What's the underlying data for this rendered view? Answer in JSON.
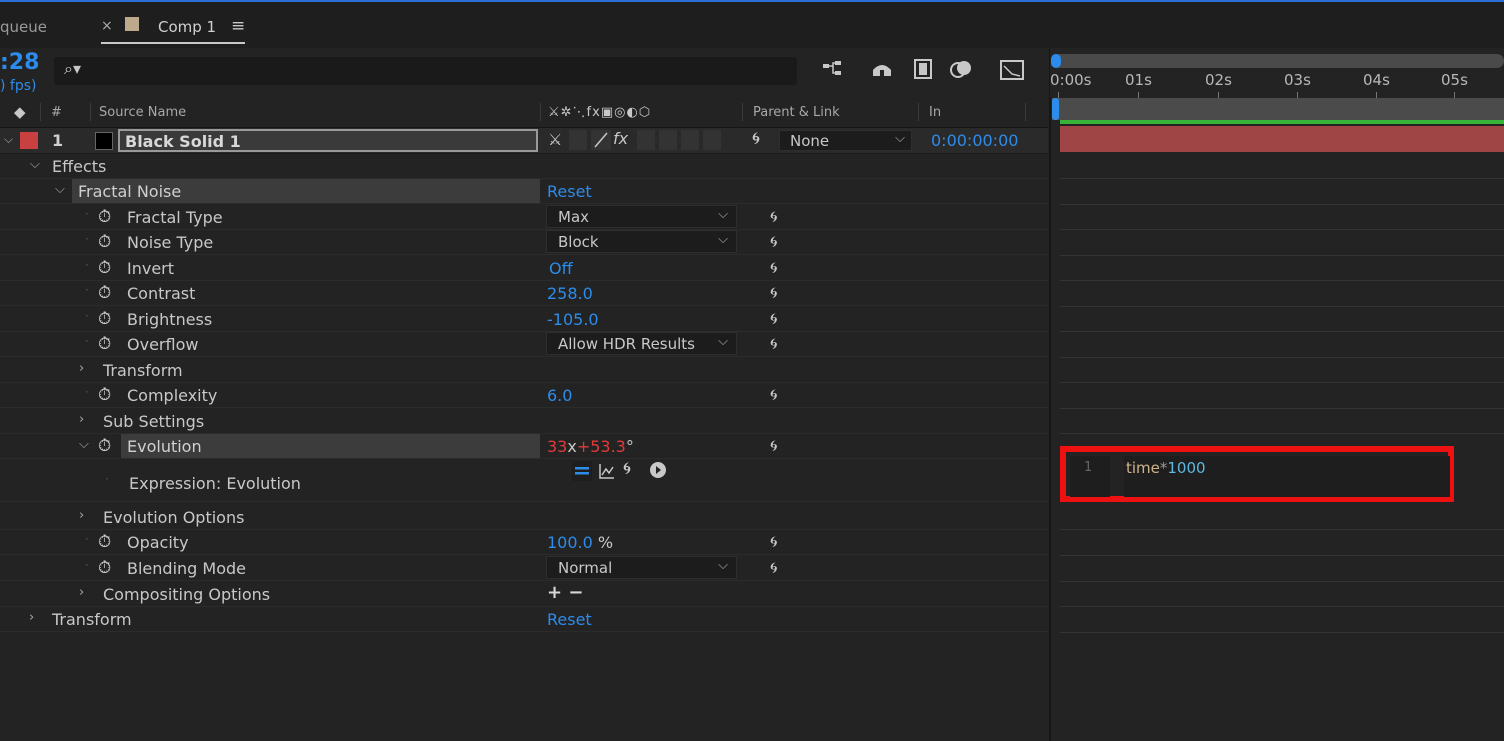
{
  "tabs": {
    "queue_label": "queue",
    "close_symbol": "×",
    "comp_label": "Comp 1",
    "menu_symbol": "≡"
  },
  "toolbar": {
    "timecode": ":28",
    "fps": ") fps)",
    "search_icon": "⌕▾"
  },
  "columns": {
    "tag": "◆",
    "number": "#",
    "source_name": "Source Name",
    "switch_icons": "⚔✲⋱fx▣◎◐⬡",
    "parent_link": "Parent & Link",
    "in": "In"
  },
  "layer": {
    "number": "1",
    "name": "Black Solid 1",
    "parent": "None",
    "in_time": "0:00:00:00",
    "switches": "⚔",
    "label_color": "#c84040"
  },
  "effects_group": "Effects",
  "effect": {
    "name": "Fractal Noise",
    "reset_label": "Reset"
  },
  "properties": {
    "fractal_type": {
      "label": "Fractal Type",
      "value": "Max"
    },
    "noise_type": {
      "label": "Noise Type",
      "value": "Block"
    },
    "invert": {
      "label": "Invert",
      "value": "Off"
    },
    "contrast": {
      "label": "Contrast",
      "value": "258.0"
    },
    "brightness": {
      "label": "Brightness",
      "value": "-105.0"
    },
    "overflow": {
      "label": "Overflow",
      "value": "Allow HDR Results"
    },
    "transform": {
      "label": "Transform"
    },
    "complexity": {
      "label": "Complexity",
      "value": "6.0"
    },
    "sub_settings": {
      "label": "Sub Settings"
    },
    "evolution": {
      "label": "Evolution",
      "revolutions": "33",
      "x": "x",
      "degrees": "+53.3",
      "degree_symbol": "°"
    },
    "expression_label": "Expression: Evolution",
    "evolution_options": {
      "label": "Evolution Options"
    },
    "opacity": {
      "label": "Opacity",
      "value": "100.0",
      "unit": "%"
    },
    "blending_mode": {
      "label": "Blending Mode",
      "value": "Normal"
    },
    "compositing_options": {
      "label": "Compositing Options",
      "add_remove": "+ −"
    }
  },
  "layer_transform": {
    "label": "Transform",
    "reset_label": "Reset"
  },
  "ruler": {
    "ticks": [
      "0:00s",
      "01s",
      "02s",
      "03s",
      "04s",
      "05s"
    ]
  },
  "expression": {
    "line_number": "1",
    "identifier": "time",
    "operator": "*",
    "number": "1000"
  }
}
